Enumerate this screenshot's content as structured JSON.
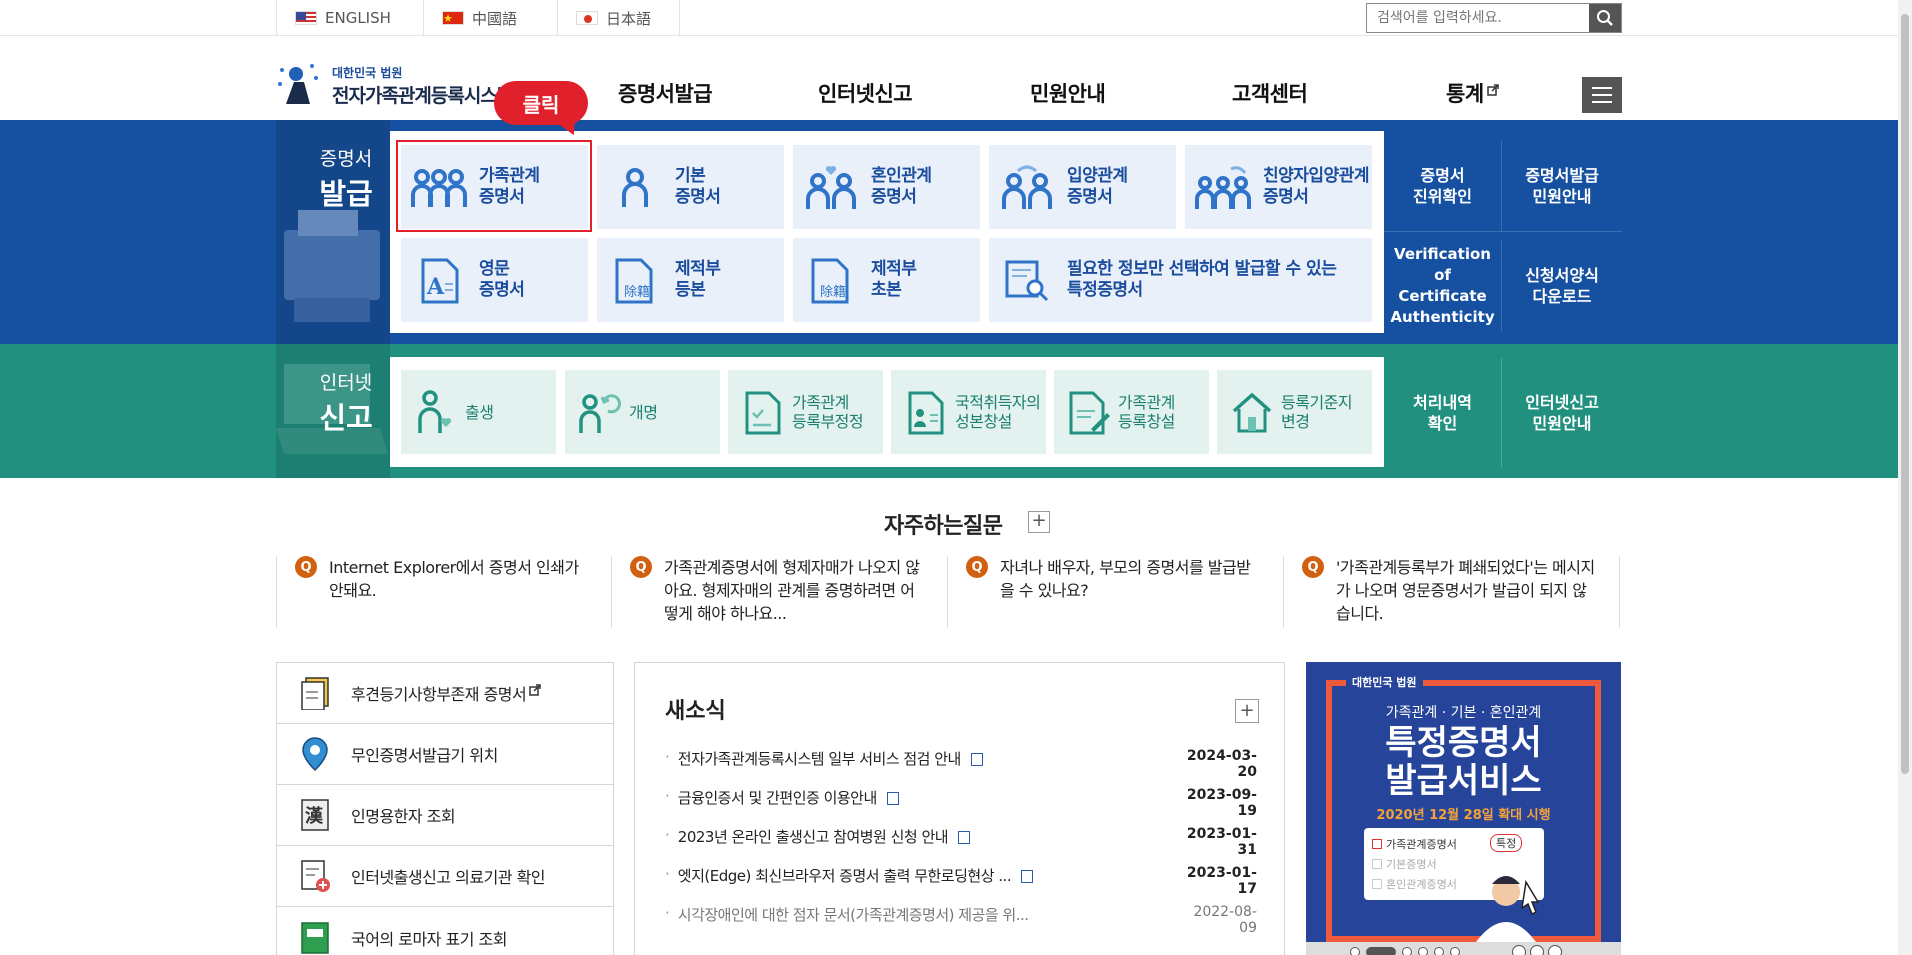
{
  "languages": [
    {
      "label": "ENGLISH",
      "flag": "us-flag"
    },
    {
      "label": "中國語",
      "flag": "cn-flag"
    },
    {
      "label": "日本語",
      "flag": "jp-flag"
    }
  ],
  "search": {
    "placeholder": "검색어를 입력하세요."
  },
  "logo": {
    "sub": "대한민국 법원",
    "main": "전자가족관계등록시스템"
  },
  "nav": [
    "증명서발급",
    "인터넷신고",
    "민원안내",
    "고객센터",
    "통계"
  ],
  "callout": "클릭",
  "cert": {
    "title_small": "증명서",
    "title_large": "발급",
    "cards": [
      "가족관계\n증명서",
      "기본\n증명서",
      "혼인관계\n증명서",
      "입양관계\n증명서",
      "친양자입양관계\n증명서",
      "영문\n증명서",
      "제적부\n등본",
      "제적부\n초본",
      "필요한 정보만 선택하여 발급할 수 있는\n특정증명서"
    ],
    "side_links": [
      "증명서\n진위확인",
      "증명서발급\n민원안내",
      "Verification of\nCertificate\nAuthenticity",
      "신청서양식\n다운로드"
    ]
  },
  "internet": {
    "title_small": "인터넷",
    "title_large": "신고",
    "cards": [
      "출생",
      "개명",
      "가족관계\n등록부정정",
      "국적취득자의\n성본창설",
      "가족관계\n등록창설",
      "등록기준지\n변경"
    ],
    "side_links": [
      "처리내역\n확인",
      "인터넷신고\n민원안내"
    ]
  },
  "faq": {
    "title": "자주하는질문",
    "more": "+",
    "badge": "Q",
    "items": [
      "Internet Explorer에서 증명서 인쇄가 안돼요.",
      "가족관계증명서에 형제자매가 나오지 않아요. 형제자매의 관계를 증명하려면 어떻게 해야 하나요...",
      "자녀나 배우자, 부모의 증명서를 발급받을 수 있나요?",
      "'가족관계등록부가 폐쇄되었다'는 메시지가 나오며 영문증명서가 발급이 되지 않습니다."
    ]
  },
  "quick_links": [
    "후견등기사항부존재 증명서",
    "무인증명서발급기 위치",
    "인명용한자 조회",
    "인터넷출생신고 의료기관 확인",
    "국어의 로마자 표기 조회"
  ],
  "news": {
    "title": "새소식",
    "more": "+",
    "items": [
      {
        "title": "전자가족관계등록시스템 일부 서비스 점검 안내",
        "date": "2024-03-20"
      },
      {
        "title": "금융인증서 및 간편인증 이용안내",
        "date": "2023-09-19"
      },
      {
        "title": "2023년 온라인 출생신고 참여병원 신청 안내",
        "date": "2023-01-31"
      },
      {
        "title": "엣지(Edge) 최신브라우저 증명서 출력 무한로딩현상 ...",
        "date": "2023-01-17"
      },
      {
        "title": "시각장애인에 대한 점자 문서(가족관계증명서) 제공을 위...",
        "date": "2022-08-09"
      }
    ]
  },
  "banner": {
    "org": "대한민국 법원",
    "subtitle": "가족관계 · 기본 · 혼인관계",
    "line1": "특정증명서",
    "line2": "발급서비스",
    "date_note": "2020년 12월 28일 확대 시행",
    "checklist": [
      "가족관계증명서",
      "기본증명서",
      "혼인관계증명서"
    ],
    "option": "특정"
  },
  "colors": {
    "blue_band": "#1650a0",
    "green_band": "#22907f",
    "highlight": "#e0202a",
    "faq_badge": "#d2610f"
  }
}
